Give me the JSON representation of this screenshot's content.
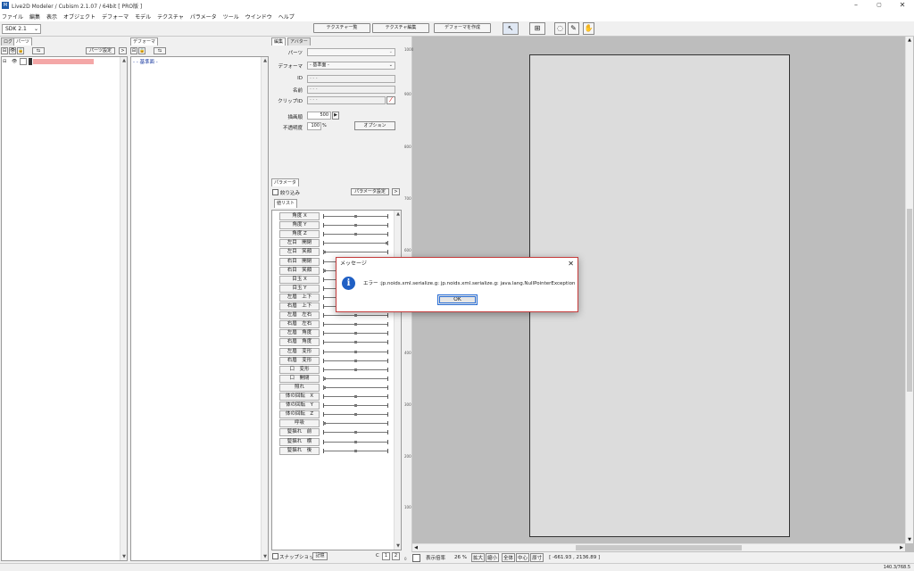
{
  "window": {
    "title": "Live2D Modeler / Cubism 2.1.07 / 64bit  [ PRO版 ]",
    "minimize": "–",
    "maximize": "▢",
    "close": "✕"
  },
  "menu": [
    "ファイル",
    "編集",
    "表示",
    "オブジェクト",
    "デフォーマ",
    "モデル",
    "テクスチャ",
    "パラメータ",
    "ツール",
    "ウインドウ",
    "ヘルプ"
  ],
  "toolbar": {
    "sdk_value": "SDK 2.1",
    "texture_list": "テクスチャ一覧",
    "texture_edit": "テクスチャ編集",
    "create_deformer": "デフォーマを作成"
  },
  "parts_panel": {
    "tab_log": "ログ",
    "tab_parts": "パーツ",
    "settings_btn": "パーツ設定",
    "arrow_btn": ">",
    "part_color": "#f4a7a7"
  },
  "deformer_panel": {
    "tab": "デフォーマ",
    "root_item": "- - 基準面 -"
  },
  "edit_panel": {
    "tab_edit": "編集",
    "tab_avatar": "アバター",
    "label_parts": "パーツ",
    "label_deformer": "デフォーマ",
    "deformer_value": "- 基準面 -",
    "label_id": "ID",
    "id_value": "- - -",
    "label_name": "名前",
    "name_value": "- - -",
    "label_clip": "クリップID",
    "clip_value": "- - -",
    "label_draw_order": "描画順",
    "draw_order_value": "500",
    "label_opacity": "不透明度",
    "opacity_value": "100",
    "opacity_unit": "%",
    "option_btn": "オプション"
  },
  "param_panel": {
    "tab": "パラメータ",
    "filter_label": "絞り込み",
    "settings_btn": "パラメータ設定",
    "arrow_btn": ">",
    "list_tab": "値リスト",
    "params": [
      {
        "name": "角度 X",
        "knob": 0.5
      },
      {
        "name": "角度 Y",
        "knob": 0.5
      },
      {
        "name": "角度 Z",
        "knob": 0.5
      },
      {
        "name": "左目　開閉",
        "knob": 1.0
      },
      {
        "name": "左目　笑顔",
        "knob": 0.0
      },
      {
        "name": "右目　開閉",
        "knob": 1.0
      },
      {
        "name": "右目　笑顔",
        "knob": 0.0
      },
      {
        "name": "目玉 X",
        "knob": 0.5
      },
      {
        "name": "目玉 Y",
        "knob": 0.5
      },
      {
        "name": "左眉　上下",
        "knob": 0.5
      },
      {
        "name": "右眉　上下",
        "knob": 0.5
      },
      {
        "name": "左眉　左右",
        "knob": 0.5
      },
      {
        "name": "右眉　左右",
        "knob": 0.5
      },
      {
        "name": "左眉　角度",
        "knob": 0.5
      },
      {
        "name": "右眉　角度",
        "knob": 0.5
      },
      {
        "name": "左眉　変形",
        "knob": 0.5
      },
      {
        "name": "右眉　変形",
        "knob": 0.5
      },
      {
        "name": "口　変形",
        "knob": 0.5
      },
      {
        "name": "口　開閉",
        "knob": 0.0
      },
      {
        "name": "照れ",
        "knob": 0.0
      },
      {
        "name": "体の回転　X",
        "knob": 0.5
      },
      {
        "name": "体の回転　Y",
        "knob": 0.5
      },
      {
        "name": "体の回転　Z",
        "knob": 0.5
      },
      {
        "name": "呼吸",
        "knob": 0.0
      },
      {
        "name": "髪揺れ　前",
        "knob": 0.5
      },
      {
        "name": "髪揺れ　横",
        "knob": 0.5
      },
      {
        "name": "髪揺れ　後",
        "knob": 0.5
      }
    ],
    "snapshot_label": "スナップショット",
    "memory_btn": "記憶",
    "c_label": "C",
    "slot1": "1",
    "slot2": "2"
  },
  "canvas": {
    "ruler_labels": [
      "1000",
      "900",
      "800",
      "700",
      "600",
      "500",
      "400",
      "300",
      "200",
      "100",
      "0"
    ],
    "zoom_label": "表示倍率",
    "zoom_value": "26 %",
    "zoom_in": "拡大",
    "zoom_out": "縮小",
    "fit_all": "全体",
    "center": "中心",
    "actual": "原寸",
    "coords": "[ -661.93 , 2136.89 ]"
  },
  "status": {
    "right": "140.3/768.5"
  },
  "dialog": {
    "title": "メッセージ",
    "close": "✕",
    "icon": "i",
    "message": "エラー :jp.noids.xml.serialize.g: jp.noids.xml.serialize.g: java.lang.NullPointerException",
    "ok": "OK"
  }
}
